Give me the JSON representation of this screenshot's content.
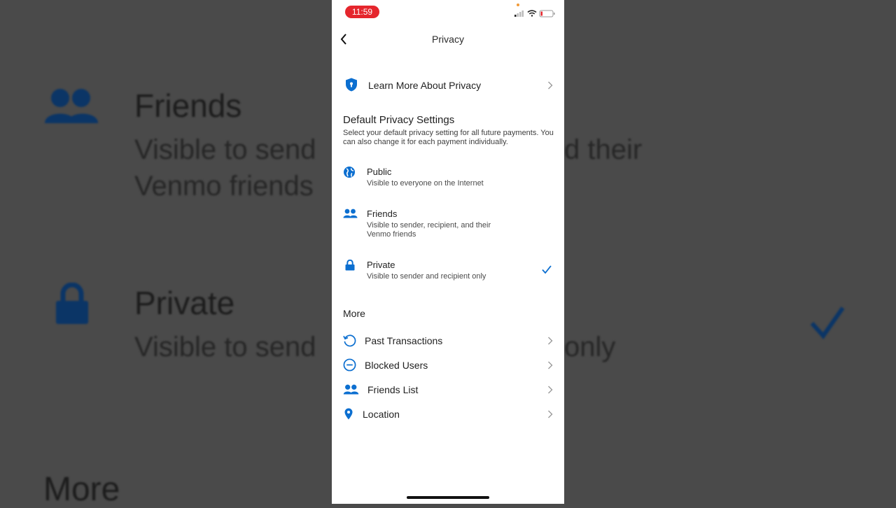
{
  "colors": {
    "accent": "#0c6fd0",
    "time_badge": "#e5262d",
    "background_overlay": "#4a4a4a"
  },
  "background": {
    "friends_title": "Friends",
    "friends_desc_left_1": "Visible to send",
    "friends_desc_right_1": "d their",
    "friends_desc_left_2": "Venmo friends",
    "private_title": "Private",
    "private_desc_left": "Visible to send",
    "private_desc_right": "only",
    "more_title": "More"
  },
  "status_bar": {
    "time": "11:59",
    "icons": [
      "signal-icon",
      "wifi-icon",
      "battery-icon"
    ]
  },
  "nav": {
    "title": "Privacy",
    "back_icon": "chevron-left-icon"
  },
  "learn_more": {
    "label": "Learn More About Privacy",
    "icon": "shield-lock-icon"
  },
  "default_settings": {
    "title": "Default Privacy Settings",
    "description": "Select your default privacy setting for all future payments. You can also change it for each payment individually.",
    "options": [
      {
        "title": "Public",
        "description": "Visible to everyone on the Internet",
        "icon": "globe-icon",
        "selected": false
      },
      {
        "title": "Friends",
        "description": "Visible to sender, recipient, and their Venmo friends",
        "icon": "friends-icon",
        "selected": false
      },
      {
        "title": "Private",
        "description": "Visible to sender and recipient only",
        "icon": "lock-icon",
        "selected": true
      }
    ]
  },
  "more": {
    "title": "More",
    "items": [
      {
        "label": "Past Transactions",
        "icon": "history-icon"
      },
      {
        "label": "Blocked Users",
        "icon": "blocked-icon"
      },
      {
        "label": "Friends List",
        "icon": "friends-icon"
      },
      {
        "label": "Location",
        "icon": "location-pin-icon"
      }
    ]
  }
}
